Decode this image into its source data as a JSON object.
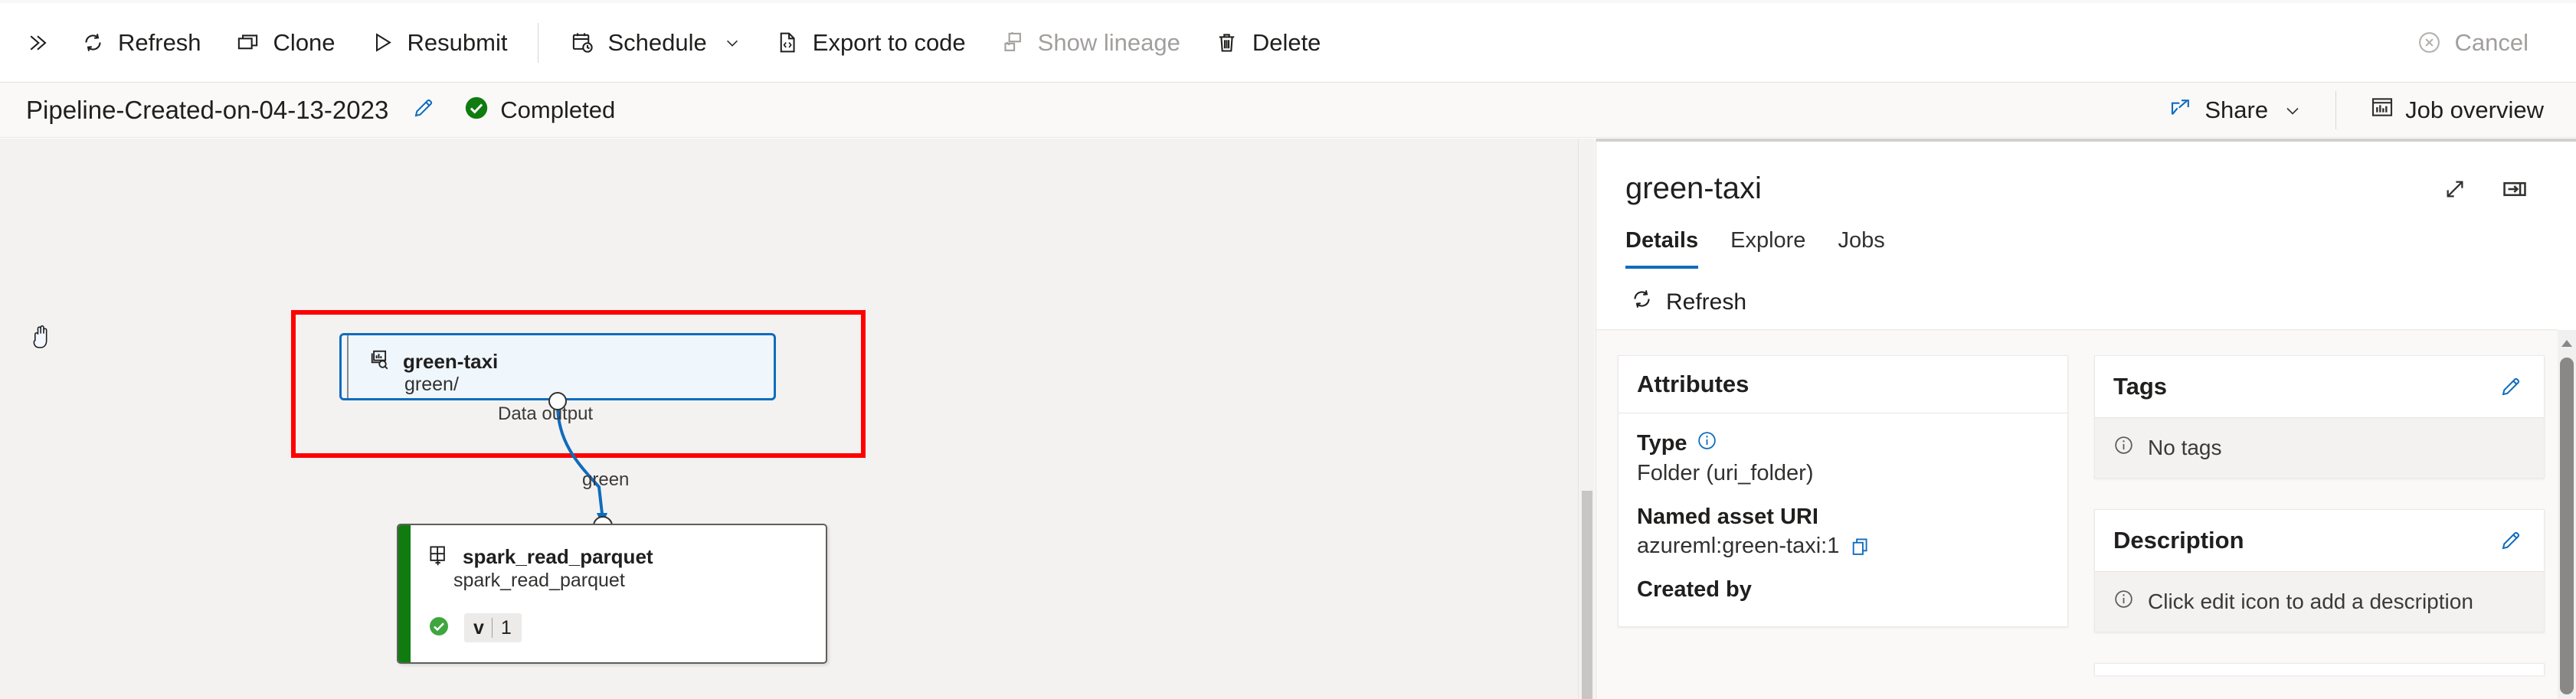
{
  "command_bar": {
    "expand_icon": "double-chevron-right-icon",
    "items": [
      {
        "label": "Refresh",
        "icon": "refresh-icon",
        "disabled": false,
        "has_chevron": false
      },
      {
        "label": "Clone",
        "icon": "clone-icon",
        "disabled": false,
        "has_chevron": false
      },
      {
        "label": "Resubmit",
        "icon": "play-triangle-icon",
        "disabled": false,
        "has_chevron": false
      },
      {
        "label": "Schedule",
        "icon": "calendar-clock-icon",
        "disabled": false,
        "has_chevron": true
      },
      {
        "label": "Export to code",
        "icon": "code-file-icon",
        "disabled": false,
        "has_chevron": false
      },
      {
        "label": "Show lineage",
        "icon": "lineage-icon",
        "disabled": true,
        "has_chevron": false
      },
      {
        "label": "Delete",
        "icon": "trash-icon",
        "disabled": false,
        "has_chevron": false
      }
    ],
    "cancel": {
      "label": "Cancel",
      "icon": "cancel-circle-icon",
      "disabled": true
    }
  },
  "sub_header": {
    "pipeline_name": "Pipeline-Created-on-04-13-2023",
    "edit_icon": "pencil-icon",
    "status": {
      "text": "Completed",
      "icon": "checkmark-circle-icon",
      "color": "#107c10"
    },
    "share": {
      "label": "Share",
      "icon": "share-icon",
      "has_chevron": true
    },
    "job_overview": {
      "label": "Job overview",
      "icon": "chart-report-icon"
    }
  },
  "canvas": {
    "cursor": "grab-hand-cursor",
    "highlight_color": "#ff0000",
    "nodes": [
      {
        "id": "green-taxi",
        "title": "green-taxi",
        "subtitle": "green/",
        "icon": "dataset-search-icon",
        "kind": "dataset",
        "selected": true,
        "accent_color": "#0f6cbd",
        "output_port_label": "Data output"
      },
      {
        "id": "spark_read_parquet",
        "title": "spark_read_parquet",
        "subtitle": "spark_read_parquet",
        "icon": "component-grid-plus-icon",
        "kind": "component",
        "selected": false,
        "accent_color": "#107c10",
        "status_icon": "checkmark-circle-icon",
        "version_label": "v",
        "version_number": "1"
      }
    ],
    "edges": [
      {
        "from": "green-taxi",
        "to": "spark_read_parquet",
        "label": "green",
        "color": "#0f6cbd"
      }
    ]
  },
  "details_panel": {
    "title": "green-taxi",
    "header_icons": [
      {
        "name": "expand-diagonal-icon"
      },
      {
        "name": "collapse-panel-right-icon"
      }
    ],
    "tabs": [
      {
        "label": "Details",
        "active": true
      },
      {
        "label": "Explore",
        "active": false
      },
      {
        "label": "Jobs",
        "active": false
      }
    ],
    "refresh": {
      "label": "Refresh",
      "icon": "refresh-icon"
    },
    "attributes_card": {
      "title": "Attributes",
      "rows": [
        {
          "label": "Type",
          "info_icon": "info-circle-icon",
          "value": "Folder (uri_folder)",
          "copy_icon": null
        },
        {
          "label": "Named asset URI",
          "info_icon": null,
          "value": "azureml:green-taxi:1",
          "copy_icon": "copy-icon"
        },
        {
          "label": "Created by",
          "info_icon": null,
          "value": "",
          "copy_icon": null
        }
      ]
    },
    "tags_card": {
      "title": "Tags",
      "edit_icon": "pencil-icon",
      "empty_text": "No tags",
      "empty_icon": "info-circle-icon"
    },
    "description_card": {
      "title": "Description",
      "edit_icon": "pencil-icon",
      "empty_text": "Click edit icon to add a description",
      "empty_icon": "info-circle-icon"
    }
  },
  "colors": {
    "accent": "#0f6cbd",
    "success": "#107c10",
    "highlight": "#ff0000",
    "canvas_bg": "#f3f2f1"
  }
}
